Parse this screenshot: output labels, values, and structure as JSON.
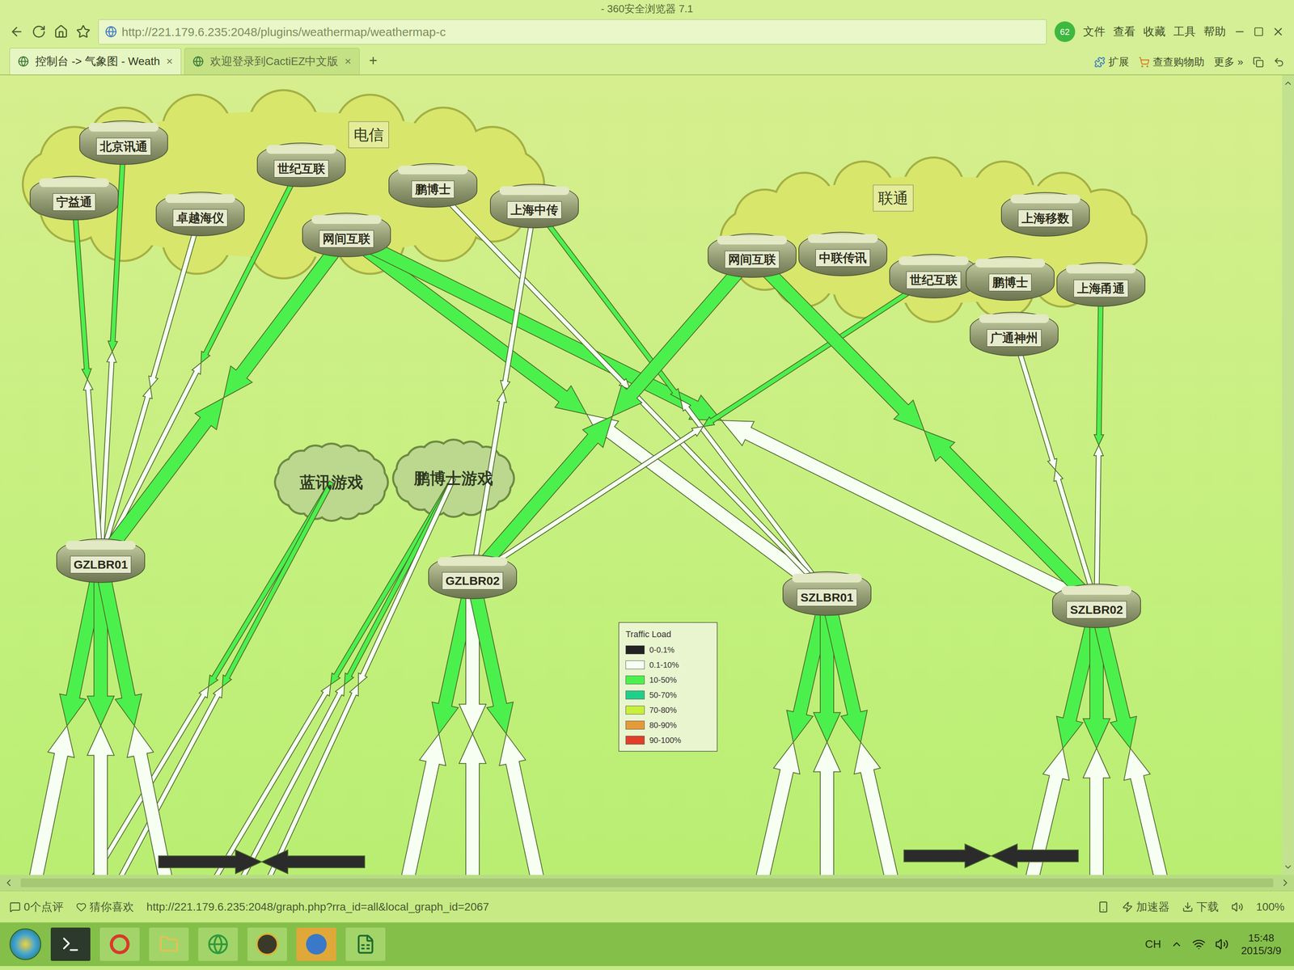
{
  "browser": {
    "title": "- 360安全浏览器 7.1",
    "url": "http://221.179.6.235:2048/plugins/weathermap/weathermap-c",
    "badge": "62",
    "menu": [
      "文件",
      "查看",
      "收藏",
      "工具",
      "帮助"
    ],
    "tabs": [
      {
        "label": "控制台 -> 气象图 - Weath",
        "selected": true
      },
      {
        "label": "欢迎登录到CactiEZ中文版",
        "selected": false
      }
    ],
    "close_glyph": "×",
    "new_tab": "+",
    "extensions": [
      "扩展",
      "查查购物助",
      "更多 »"
    ]
  },
  "map": {
    "nodes": [
      {
        "label": "电信",
        "kind": "group"
      },
      {
        "label": "北京讯通",
        "kind": "router"
      },
      {
        "label": "宁益通",
        "kind": "router"
      },
      {
        "label": "卓越海仪",
        "kind": "router"
      },
      {
        "label": "世纪互联",
        "kind": "router"
      },
      {
        "label": "网间互联",
        "kind": "router"
      },
      {
        "label": "鹏博士",
        "kind": "router"
      },
      {
        "label": "上海中传",
        "kind": "router"
      },
      {
        "label": "联通",
        "kind": "group"
      },
      {
        "label": "网间互联",
        "kind": "router"
      },
      {
        "label": "中联传讯",
        "kind": "router"
      },
      {
        "label": "世纪互联",
        "kind": "router"
      },
      {
        "label": "鹏博士",
        "kind": "router"
      },
      {
        "label": "上海移数",
        "kind": "router"
      },
      {
        "label": "上海甬通",
        "kind": "router"
      },
      {
        "label": "广通神州",
        "kind": "router"
      },
      {
        "label": "蓝讯游戏",
        "kind": "cloud",
        "downlinks": [
          {
            "colors": [
              "#4cf04c",
              "#f6fff2"
            ]
          },
          {
            "colors": [
              "#4cf04c",
              "#f6fff2"
            ]
          }
        ]
      },
      {
        "label": "鹏博士游戏",
        "kind": "cloud",
        "downlinks": [
          {
            "colors": [
              "#4cf04c",
              "#f6fff2"
            ]
          },
          {
            "colors": [
              "#4cf04c",
              "#f6fff2"
            ]
          },
          {
            "colors": [
              "#f6fff2",
              "#f6fff2"
            ]
          }
        ]
      },
      {
        "label": "GZLBR01",
        "kind": "router",
        "downlinks": [
          {
            "colors": [
              "#4cf04c",
              "#f6fff2"
            ]
          },
          {
            "colors": [
              "#4cf04c",
              "#f6fff2"
            ]
          },
          {
            "colors": [
              "#4cf04c",
              "#f6fff2"
            ]
          }
        ]
      },
      {
        "label": "GZLBR02",
        "kind": "router",
        "downlinks": [
          {
            "colors": [
              "#4cf04c",
              "#f6fff2"
            ]
          },
          {
            "colors": [
              "#f6fff2",
              "#f6fff2"
            ]
          },
          {
            "colors": [
              "#4cf04c",
              "#f6fff2"
            ]
          }
        ]
      },
      {
        "label": "SZLBR01",
        "kind": "router",
        "downlinks": [
          {
            "colors": [
              "#4cf04c",
              "#f6fff2"
            ]
          },
          {
            "colors": [
              "#4cf04c",
              "#f6fff2"
            ]
          },
          {
            "colors": [
              "#4cf04c",
              "#f6fff2"
            ]
          }
        ]
      },
      {
        "label": "SZLBR02",
        "kind": "router",
        "downlinks": [
          {
            "colors": [
              "#4cf04c",
              "#f6fff2"
            ]
          },
          {
            "colors": [
              "#4cf04c",
              "#f6fff2"
            ]
          },
          {
            "colors": [
              "#4cf04c",
              "#f6fff2"
            ]
          }
        ]
      }
    ],
    "links": [
      {
        "from": 1,
        "to": 18,
        "colors": [
          "#4cf04c",
          "#f6fff2"
        ],
        "kind": "narrow"
      },
      {
        "from": 2,
        "to": 18,
        "colors": [
          "#4cf04c",
          "#f6fff2"
        ],
        "kind": "narrow"
      },
      {
        "from": 3,
        "to": 18,
        "colors": [
          "#f6fff2",
          "#f6fff2"
        ],
        "kind": "narrow"
      },
      {
        "from": 4,
        "to": 18,
        "colors": [
          "#4cf04c",
          "#f6fff2"
        ],
        "kind": "narrow"
      },
      {
        "from": 5,
        "to": 18,
        "colors": [
          "#4cf04c",
          "#4cf04c"
        ],
        "kind": "wide"
      },
      {
        "from": 5,
        "to": 20,
        "colors": [
          "#4cf04c",
          "#f6fff2"
        ],
        "kind": "wide"
      },
      {
        "from": 5,
        "to": 21,
        "colors": [
          "#4cf04c",
          "#f6fff2"
        ],
        "kind": "wide"
      },
      {
        "from": 7,
        "to": 20,
        "colors": [
          "#4cf04c",
          "#f6fff2"
        ],
        "kind": "narrow"
      },
      {
        "from": 6,
        "to": 20,
        "colors": [
          "#f6fff2",
          "#f6fff2"
        ],
        "kind": "narrow"
      },
      {
        "from": 7,
        "to": 19,
        "colors": [
          "#f6fff2",
          "#f6fff2"
        ],
        "kind": "narrow"
      },
      {
        "from": 9,
        "to": 19,
        "colors": [
          "#4cf04c",
          "#4cf04c"
        ],
        "kind": "wide"
      },
      {
        "from": 11,
        "to": 19,
        "colors": [
          "#4cf04c",
          "#f6fff2"
        ],
        "kind": "narrow"
      },
      {
        "from": 9,
        "to": 21,
        "colors": [
          "#4cf04c",
          "#4cf04c"
        ],
        "kind": "wide"
      },
      {
        "from": 15,
        "to": 21,
        "colors": [
          "#f6fff2",
          "#f6fff2"
        ],
        "kind": "narrow"
      },
      {
        "from": 14,
        "to": 21,
        "colors": [
          "#4cf04c",
          "#f6fff2"
        ],
        "kind": "narrow"
      }
    ],
    "offscreen_links": [
      {
        "colors": [
          "#2b2b2b",
          "#2b2b2b"
        ]
      },
      {
        "colors": [
          "#2b2b2b",
          "#2b2b2b"
        ]
      }
    ]
  },
  "legend": {
    "title": "Traffic Load",
    "items": [
      {
        "label": "0-0.1%",
        "color": "#222222"
      },
      {
        "label": "0.1-10%",
        "color": "#f6fff2"
      },
      {
        "label": "10-50%",
        "color": "#4cf04c"
      },
      {
        "label": "50-70%",
        "color": "#1fd08a"
      },
      {
        "label": "70-80%",
        "color": "#c8f03a"
      },
      {
        "label": "80-90%",
        "color": "#e39a3a"
      },
      {
        "label": "90-100%",
        "color": "#e0402a"
      }
    ]
  },
  "status_bar": {
    "comments": "0个点评",
    "recommend": "猜你喜欢",
    "link": "http://221.179.6.235:2048/graph.php?rra_id=all&local_graph_id=2067",
    "accelerator": "加速器",
    "download": "下载",
    "zoom": "100%"
  },
  "taskbar": {
    "language": "CH",
    "time": "15:48",
    "date": "2015/3/9"
  }
}
